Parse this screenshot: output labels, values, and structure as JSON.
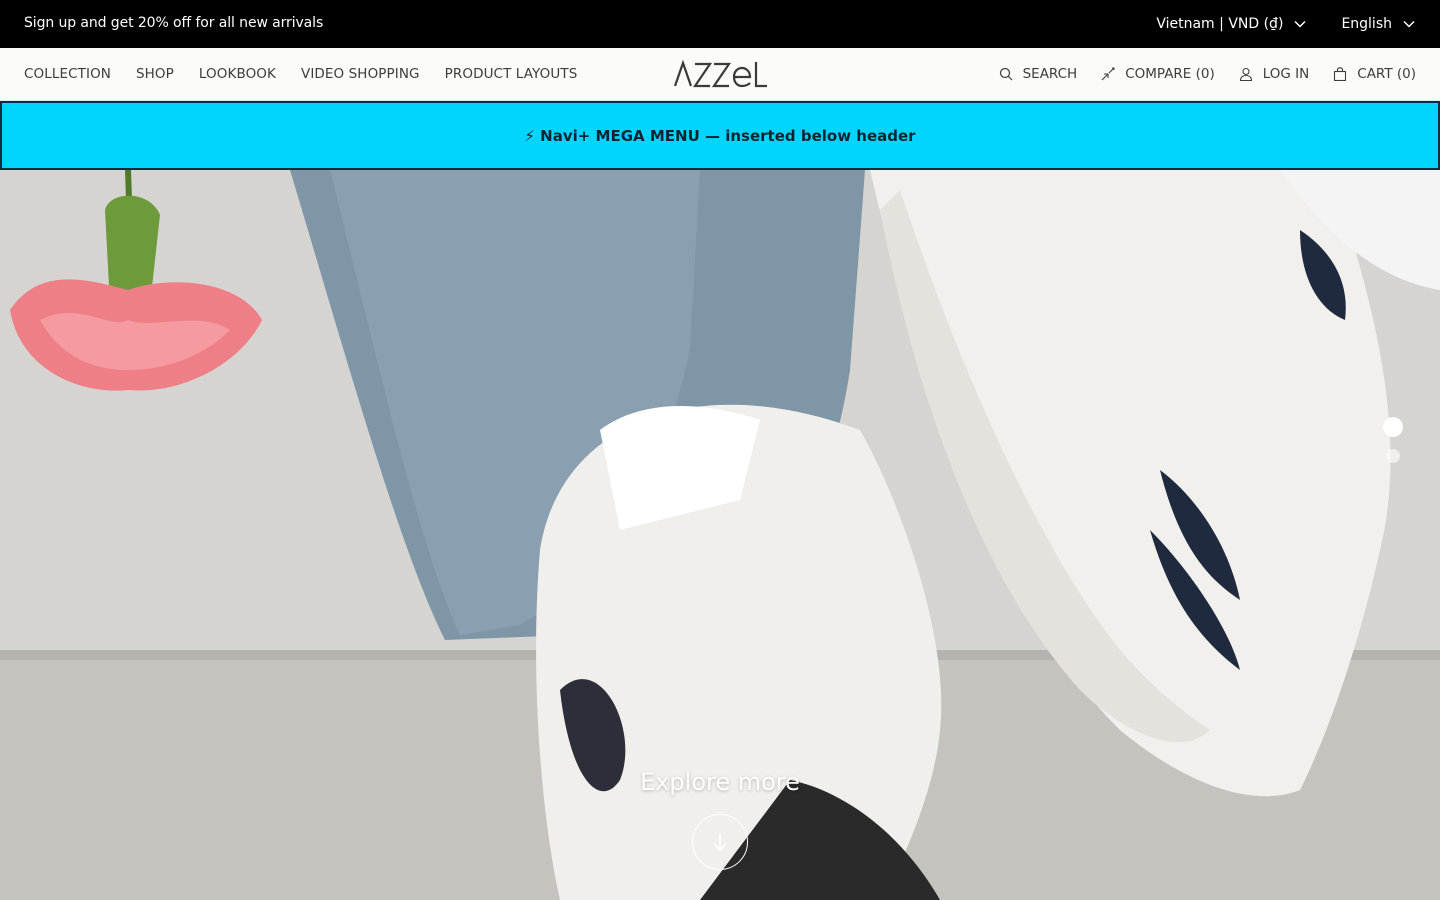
{
  "announcement": {
    "text": "Sign up and get 20% off for all new arrivals",
    "region_label": "Vietnam | VND (₫)",
    "language_label": "English"
  },
  "header": {
    "nav_links": [
      "COLLECTION",
      "SHOP",
      "LOOKBOOK",
      "VIDEO SHOPPING",
      "PRODUCT LAYOUTS"
    ],
    "logo_text": "AZZEL",
    "search_label": "SEARCH",
    "compare_label": "COMPARE (0)",
    "login_label": "LOG IN",
    "cart_label": "CART (0)"
  },
  "mega_menu": {
    "text": "⚡ Navi+ MEGA MENU — inserted below header"
  },
  "hero": {
    "cta_text": "Explore more",
    "slide_count": 2,
    "active_slide": 1
  },
  "colors": {
    "announcement_bg": "#000000",
    "header_bg": "#fbfbf9",
    "mega_menu_bg": "#00d4ff",
    "text_dark": "#3d3d3d"
  },
  "icons": [
    "chevron-down-icon",
    "search-icon",
    "compare-icon",
    "user-icon",
    "bag-icon",
    "arrow-down-icon"
  ]
}
